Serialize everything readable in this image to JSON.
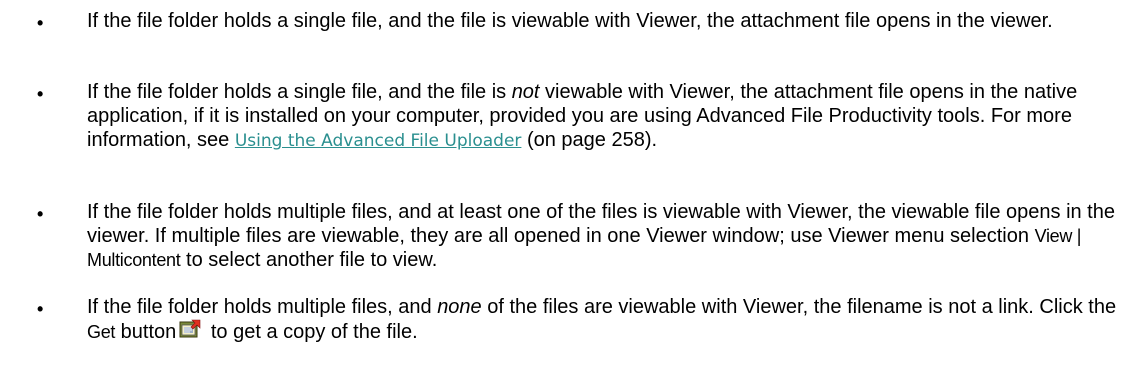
{
  "bullet_glyph": "•",
  "items": [
    {
      "parts": [
        "If the file folder holds a single file, and the file is viewable with Viewer, the attachment file opens in the viewer."
      ]
    },
    {
      "parts": [
        "If the file folder holds a single file, and the file is ",
        "not",
        " viewable with Viewer, the attachment file opens in the native application, if it is installed on your computer, provided you are using Advanced File Productivity tools. For more information, see ",
        "Using the Advanced File Uploader",
        " (on page 258)."
      ]
    },
    {
      "parts": [
        "If the file folder holds multiple files, and at least one of the files is viewable with Viewer, the viewable file opens in the viewer. If multiple files are viewable, they are all opened in one Viewer window; use Viewer menu selection ",
        "View | Multicontent",
        " to select another file to view."
      ]
    },
    {
      "parts": [
        "If the file folder holds multiple files, and ",
        "none",
        " of the files are viewable with Viewer, the filename is not a link. Click the ",
        "Get",
        " button",
        " to get a copy of the file."
      ],
      "icon": "get-file-icon"
    }
  ],
  "colors": {
    "text": "#000000",
    "link": "#2a8f8f"
  }
}
